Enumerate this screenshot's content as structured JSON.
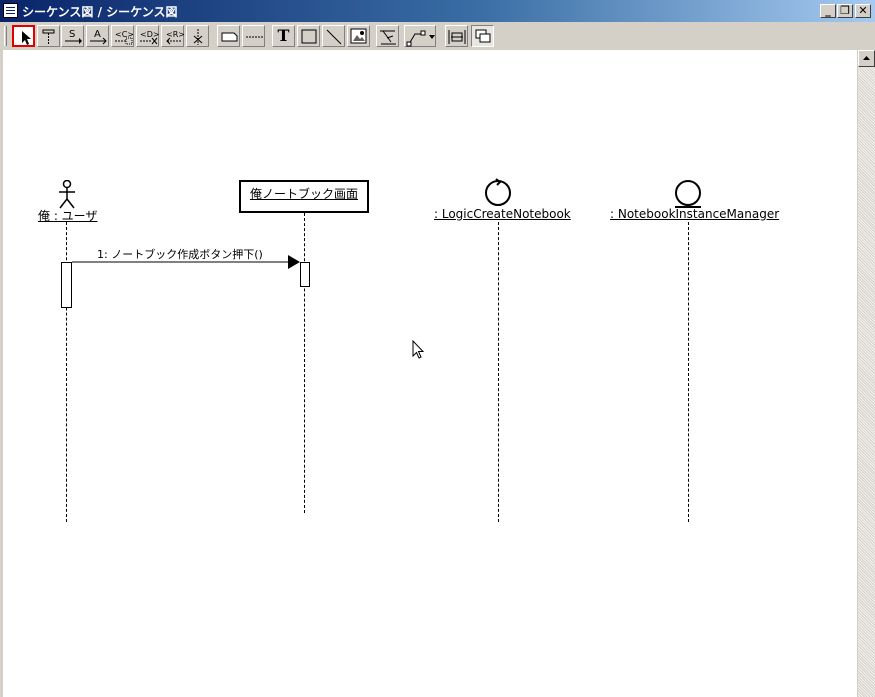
{
  "window": {
    "title": "シーケンス図 / シーケンス図"
  },
  "toolbar": {
    "text_tool_glyph": "T",
    "tools": [
      {
        "id": "select",
        "icon": "select-arrow-icon"
      },
      {
        "id": "lifeline",
        "icon": "lifeline-icon"
      },
      {
        "id": "sync-message",
        "icon": "sync-message-icon"
      },
      {
        "id": "async-message",
        "icon": "async-message-icon"
      },
      {
        "id": "create-message",
        "icon": "create-message-icon"
      },
      {
        "id": "destroy-message",
        "icon": "destroy-message-icon"
      },
      {
        "id": "reply-message",
        "icon": "reply-message-icon"
      },
      {
        "id": "stop",
        "icon": "stop-icon"
      },
      {
        "id": "note",
        "icon": "note-icon"
      },
      {
        "id": "note-anchor",
        "icon": "note-anchor-icon"
      },
      {
        "id": "text",
        "icon": "text-icon"
      },
      {
        "id": "rectangle",
        "icon": "rectangle-icon"
      },
      {
        "id": "line",
        "icon": "line-icon"
      },
      {
        "id": "image",
        "icon": "image-icon"
      },
      {
        "id": "auto-layout",
        "icon": "auto-layout-icon"
      },
      {
        "id": "line-style",
        "icon": "line-style-icon"
      },
      {
        "id": "resize",
        "icon": "resize-icon"
      },
      {
        "id": "overlap",
        "icon": "overlap-icon"
      }
    ]
  },
  "diagram": {
    "lifelines": [
      {
        "type": "actor",
        "label": "俺 : ユーザ"
      },
      {
        "type": "object",
        "label": "俺ノートブック画面"
      },
      {
        "type": "control",
        "label": ": LogicCreateNotebook"
      },
      {
        "type": "entity",
        "label": ": NotebookInstanceManager"
      }
    ],
    "messages": [
      {
        "label": "1: ノートブック作成ボタン押下()"
      }
    ]
  },
  "colors": {
    "title_start": "#0a246a",
    "title_end": "#a6caf0",
    "selection": "#e00000"
  }
}
